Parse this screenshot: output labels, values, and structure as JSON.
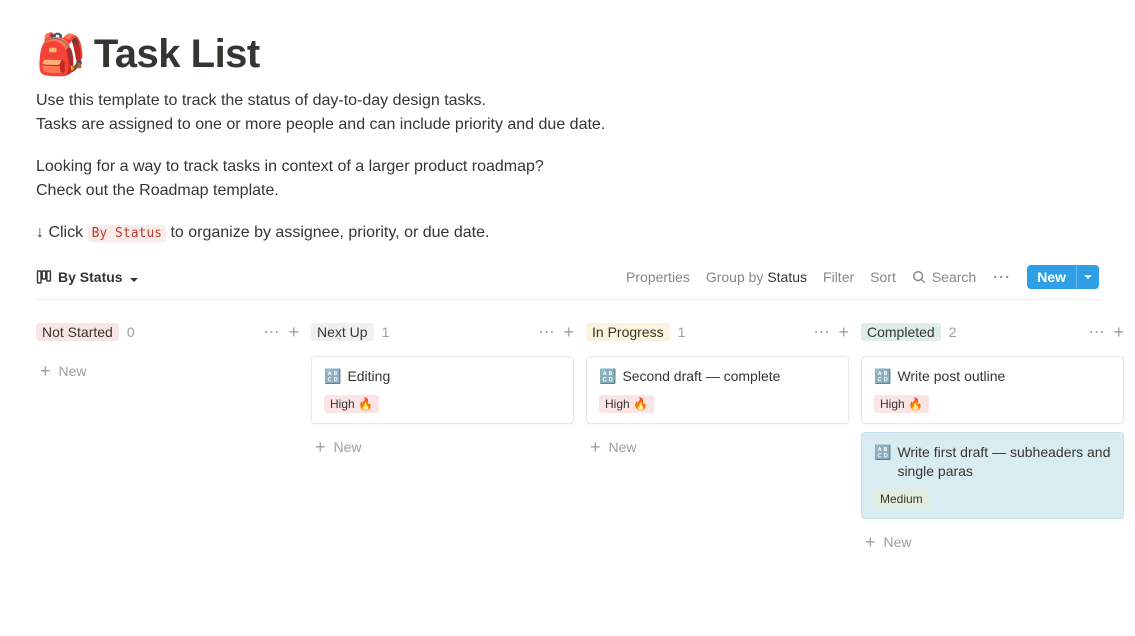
{
  "header": {
    "icon": "🎒",
    "title": "Task List",
    "desc_line1": "Use this template to track the status of day-to-day design tasks.",
    "desc_line2": "Tasks are assigned to one or more people and can include priority and due date.",
    "desc_line3": "Looking for a way to track tasks in context of a larger product roadmap?",
    "desc_line4": "Check out the Roadmap template.",
    "instruction_prefix": "↓ Click ",
    "instruction_code": "By Status",
    "instruction_suffix": " to organize by assignee, priority, or due date."
  },
  "toolbar": {
    "view_label": "By Status",
    "properties": "Properties",
    "groupby_prefix": "Group by ",
    "groupby_value": "Status",
    "filter": "Filter",
    "sort": "Sort",
    "search": "Search",
    "new_label": "New"
  },
  "columns": [
    {
      "name": "Not Started",
      "tag_class": "tag-notstarted",
      "count": "0",
      "cards": []
    },
    {
      "name": "Next Up",
      "tag_class": "tag-nextup",
      "count": "1",
      "cards": [
        {
          "icon": "🔠",
          "title": "Editing",
          "priority": "High 🔥",
          "priority_class": "priority-high",
          "selected": false
        }
      ]
    },
    {
      "name": "In Progress",
      "tag_class": "tag-inprogress",
      "count": "1",
      "cards": [
        {
          "icon": "🔠",
          "title": "Second draft — complete",
          "priority": "High 🔥",
          "priority_class": "priority-high",
          "selected": false
        }
      ]
    },
    {
      "name": "Completed",
      "tag_class": "tag-completed",
      "count": "2",
      "cards": [
        {
          "icon": "🔠",
          "title": "Write post outline",
          "priority": "High 🔥",
          "priority_class": "priority-high",
          "selected": false
        },
        {
          "icon": "🔠",
          "title": "Write first draft — subheaders and single paras",
          "priority": "Medium",
          "priority_class": "priority-medium",
          "selected": true
        }
      ]
    }
  ],
  "labels": {
    "new_card": "New"
  }
}
